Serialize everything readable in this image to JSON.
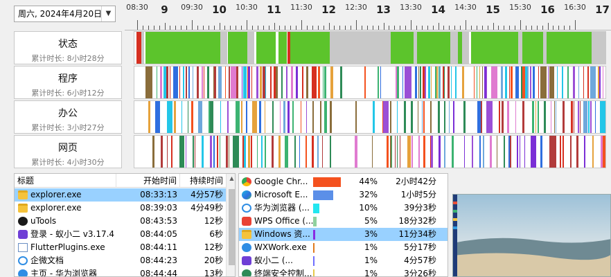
{
  "date_picker": {
    "value": "周六, 2024年4月20日",
    "dropdown_icon": "chevron-down-icon"
  },
  "time_axis": {
    "half_labels": [
      "08:30",
      "09:30",
      "10:30",
      "11:30",
      "12:30",
      "13:30",
      "14:30",
      "15:30",
      "16:30"
    ],
    "hour_labels": [
      "9",
      "10",
      "11",
      "12",
      "13",
      "14",
      "15",
      "16",
      "17"
    ]
  },
  "rows": [
    {
      "title": "状态",
      "subtitle": "累计时长: 8小时28分"
    },
    {
      "title": "程序",
      "subtitle": "累计时长: 6小时12分"
    },
    {
      "title": "办公",
      "subtitle": "累计时长: 3小时27分"
    },
    {
      "title": "网页",
      "subtitle": "累计时长: 4小时30分"
    }
  ],
  "colors": {
    "active": "#5cc42c",
    "idle": "#c8c8c8",
    "off": "#d62f20",
    "selection": "#99d1ff"
  },
  "activity_list": {
    "headers": [
      "标题",
      "开始时间",
      "持续时间"
    ],
    "rows": [
      {
        "icon": "folder-icon",
        "name": "explorer.exe",
        "start": "08:33:13",
        "duration": "4分57秒",
        "selected": true
      },
      {
        "icon": "folder-icon",
        "name": "explorer.exe",
        "start": "08:39:03",
        "duration": "4分49秒"
      },
      {
        "icon": "utools-icon",
        "name": "uTools",
        "start": "08:43:53",
        "duration": "12秒"
      },
      {
        "icon": "ant-app-icon",
        "name": "登录 - 蚁小二 v3.17.4",
        "start": "08:44:05",
        "duration": "6秒"
      },
      {
        "icon": "window-icon",
        "name": "FlutterPlugins.exe",
        "start": "08:44:11",
        "duration": "12秒"
      },
      {
        "icon": "wecom-icon",
        "name": "企微文档",
        "start": "08:44:23",
        "duration": "20秒"
      },
      {
        "icon": "browser-icon",
        "name": "主页 - 华为浏览器",
        "start": "08:44:44",
        "duration": "13秒"
      }
    ]
  },
  "app_stats": {
    "rows": [
      {
        "icon": "chrome-icon",
        "name": "Google Chr...",
        "percent": "44%",
        "duration": "2小时42分",
        "share": 0.44,
        "color": "#f4511e"
      },
      {
        "icon": "edge-icon",
        "name": "Microsoft E...",
        "percent": "32%",
        "duration": "1小时5分",
        "share": 0.32,
        "color": "#5b8fe8"
      },
      {
        "icon": "huawei-browser-icon",
        "name": "华为浏览器 (...",
        "percent": "10%",
        "duration": "39分3秒",
        "share": 0.1,
        "color": "#23e6f0"
      },
      {
        "icon": "wps-icon",
        "name": "WPS Office (...",
        "percent": "5%",
        "duration": "18分32秒",
        "share": 0.05,
        "color": "#8fd19e"
      },
      {
        "icon": "folder-icon",
        "name": "Windows 资...",
        "percent": "3%",
        "duration": "11分34秒",
        "share": 0.03,
        "color": "#8a2be2",
        "selected": true
      },
      {
        "icon": "wxwork-icon",
        "name": "WXWork.exe",
        "percent": "1%",
        "duration": "5分17秒",
        "share": 0.01,
        "color": "#e07b1f"
      },
      {
        "icon": "ant-app-icon",
        "name": "蚁小二 (...",
        "percent": "1%",
        "duration": "4分57秒",
        "share": 0.01,
        "color": "#6f6fff"
      },
      {
        "icon": "terminal-icon",
        "name": "终端安全控制...",
        "percent": "1%",
        "duration": "3分26秒",
        "share": 0.01,
        "color": "#e6c94a"
      }
    ]
  },
  "preview": {
    "image": "desktop-screenshot-thumbnail"
  }
}
